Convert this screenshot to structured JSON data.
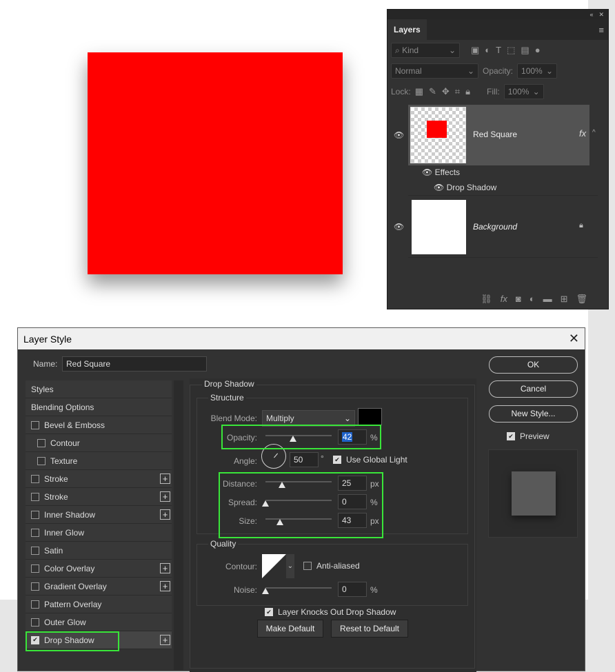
{
  "layers_panel": {
    "tab": "Layers",
    "kind_filter": "Kind",
    "blend_mode": "Normal",
    "opacity_label": "Opacity:",
    "opacity_value": "100%",
    "lock_label": "Lock:",
    "fill_label": "Fill:",
    "fill_value": "100%",
    "layers": [
      {
        "name": "Red Square",
        "fx": "fx"
      },
      {
        "name": "Background"
      }
    ],
    "effects_label": "Effects",
    "drop_shadow_label": "Drop Shadow"
  },
  "dialog": {
    "title": "Layer Style",
    "name_label": "Name:",
    "name_value": "Red Square",
    "styles": [
      {
        "label": "Styles",
        "checkbox": false,
        "indent": false,
        "plus": false
      },
      {
        "label": "Blending Options",
        "checkbox": false,
        "indent": false,
        "plus": false
      },
      {
        "label": "Bevel & Emboss",
        "checkbox": true,
        "indent": false,
        "plus": false
      },
      {
        "label": "Contour",
        "checkbox": true,
        "indent": true,
        "plus": false
      },
      {
        "label": "Texture",
        "checkbox": true,
        "indent": true,
        "plus": false
      },
      {
        "label": "Stroke",
        "checkbox": true,
        "indent": false,
        "plus": true
      },
      {
        "label": "Stroke",
        "checkbox": true,
        "indent": false,
        "plus": true
      },
      {
        "label": "Inner Shadow",
        "checkbox": true,
        "indent": false,
        "plus": true
      },
      {
        "label": "Inner Glow",
        "checkbox": true,
        "indent": false,
        "plus": false
      },
      {
        "label": "Satin",
        "checkbox": true,
        "indent": false,
        "plus": false
      },
      {
        "label": "Color Overlay",
        "checkbox": true,
        "indent": false,
        "plus": true
      },
      {
        "label": "Gradient Overlay",
        "checkbox": true,
        "indent": false,
        "plus": true
      },
      {
        "label": "Pattern Overlay",
        "checkbox": true,
        "indent": false,
        "plus": false
      },
      {
        "label": "Outer Glow",
        "checkbox": true,
        "indent": false,
        "plus": false
      },
      {
        "label": "Drop Shadow",
        "checkbox": true,
        "checked": true,
        "indent": false,
        "plus": true
      }
    ],
    "section_title": "Drop Shadow",
    "structure_title": "Structure",
    "blend_mode_label": "Blend Mode:",
    "blend_mode_value": "Multiply",
    "opacity_label": "Opacity:",
    "opacity_value": "42",
    "opacity_level": 0.42,
    "percent": "%",
    "angle_label": "Angle:",
    "angle_value": "50",
    "degree": "°",
    "use_global_light": "Use Global Light",
    "distance_label": "Distance:",
    "distance_value": "25",
    "distance_level": 0.25,
    "spread_label": "Spread:",
    "spread_value": "0",
    "spread_level": 0,
    "size_label": "Size:",
    "size_value": "43",
    "size_level": 0.22,
    "px": "px",
    "quality_title": "Quality",
    "contour_label": "Contour:",
    "anti_aliased": "Anti-aliased",
    "noise_label": "Noise:",
    "noise_value": "0",
    "noise_level": 0,
    "knocks_out": "Layer Knocks Out Drop Shadow",
    "make_default": "Make Default",
    "reset_default": "Reset to Default",
    "ok": "OK",
    "cancel": "Cancel",
    "new_style": "New Style...",
    "preview": "Preview"
  },
  "colors": {
    "red": "#ff0000",
    "highlight": "#39e639",
    "panel": "#323232"
  }
}
